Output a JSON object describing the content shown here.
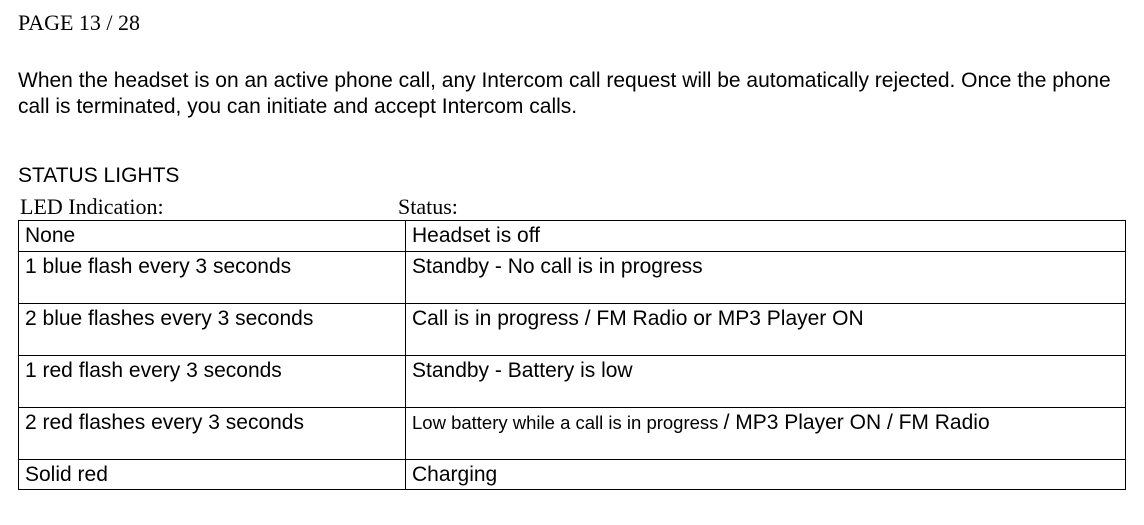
{
  "page_label": "PAGE 13 / 28",
  "body_text": "When the headset is on an active phone call, any Intercom call request will be automatically rejected. Once the phone call is terminated, you can initiate and accept Intercom calls.",
  "section_heading": "STATUS LIGHTS",
  "table_headers": {
    "left": "LED Indication:",
    "right": "Status:"
  },
  "rows": [
    {
      "led": "None",
      "status": "Headset is off",
      "tall": false
    },
    {
      "led": "1 blue flash every 3 seconds",
      "status": "Standby  - No call is in progress",
      "tall": true
    },
    {
      "led": "2 blue flashes every 3 seconds",
      "status": "Call is in progress / FM Radio or MP3 Player ON",
      "tall": true
    },
    {
      "led": "1 red flash every 3 seconds",
      "status": "Standby  - Battery is low",
      "tall": true
    },
    {
      "led": "2 red flashes every 3 seconds",
      "status_mixed": {
        "small": "Low battery while a call is in progress ",
        "normal": "/ MP3 Player ON / FM Radio"
      },
      "tall": true
    },
    {
      "led": "Solid red",
      "status": "Charging",
      "tall": false
    }
  ]
}
